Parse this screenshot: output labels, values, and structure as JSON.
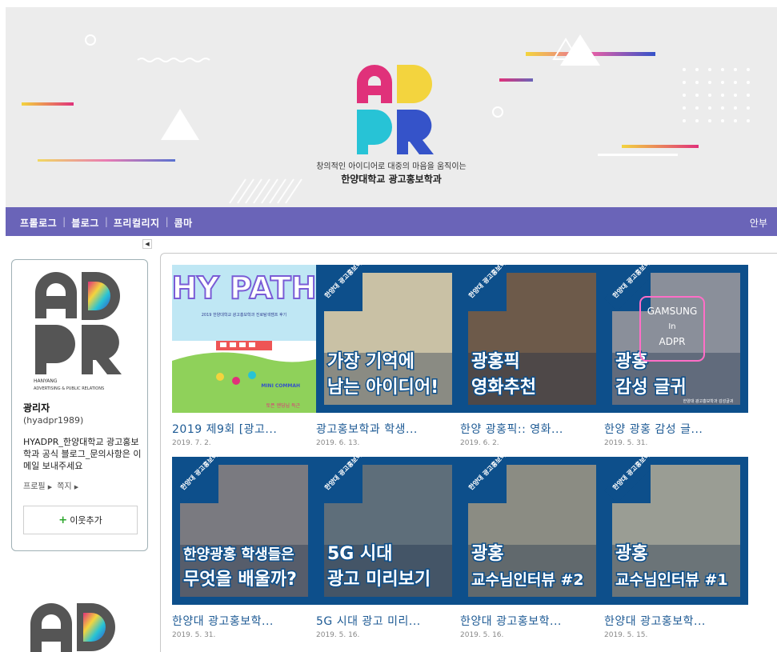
{
  "banner": {
    "tagline": "창의적인 아이디어로 대중의 마음을 움직이는",
    "department": "한양대학교 광고홍보학과",
    "logo_colors": {
      "pink": "#e0317a",
      "yellow": "#f3d43e",
      "cyan": "#27c3d6",
      "blue": "#3553c9"
    }
  },
  "nav": {
    "items": [
      "프롤로그",
      "블로그",
      "프리컬리지",
      "콤마"
    ],
    "guide": "안부",
    "bar_color": "#6a64b8"
  },
  "profile": {
    "logo_sub1": "HANYANG",
    "logo_sub2": "ADVERTISING & PUBLIC RELATIONS",
    "name": "광리자",
    "id": "(hyadpr1989)",
    "description": "HYADPR_한양대학교 광고홍보학과 공식 블로그_문의사항은 이메일 보내주세요",
    "links": [
      "프로필",
      "쪽지"
    ],
    "add_neighbor": "이웃추가"
  },
  "posts": [
    {
      "title": "2019 제9회 [광고...",
      "date": "2019. 7. 2.",
      "thumb": {
        "type": "hypath",
        "big": "HY PATH",
        "sub": "2019 한양대학교 광고홍보학과 진로탐색캠프 후기",
        "caption": "MINI COMMAH",
        "footer": "토픈 엔딩님 득근"
      }
    },
    {
      "title": "광고홍보학과 학생...",
      "date": "2019. 6. 13.",
      "thumb": {
        "type": "badge",
        "badge": "한양대 광고홍보학과",
        "line1": "가장 기억에",
        "line2": "남는 아이디어!"
      }
    },
    {
      "title": "한양 광홍픽:: 영화...",
      "date": "2019. 6. 2.",
      "thumb": {
        "type": "badge",
        "badge": "한양대 광고홍보학과",
        "line1": "광홍픽",
        "line2": "영화추천"
      }
    },
    {
      "title": "한양 광홍 감성 글...",
      "date": "2019. 5. 31.",
      "thumb": {
        "type": "badge",
        "badge": "한양대 광고홍보학과",
        "line1": "광홍",
        "line2": "감성 글귀",
        "neon1": "GAMSUNG",
        "neon2": "In",
        "neon3": "ADPR",
        "footer": "한양대 광고홍보학과 감성글귀"
      }
    },
    {
      "title": "한양대 광고홍보학...",
      "date": "2019. 5. 31.",
      "thumb": {
        "type": "badge",
        "badge": "한양대 광고홍보학과",
        "line1": "한양광홍 학생들은",
        "line2": "무엇을 배울까?"
      }
    },
    {
      "title": "5G 시대 광고 미리...",
      "date": "2019. 5. 16.",
      "thumb": {
        "type": "badge",
        "badge": "한양대 광고홍보학과",
        "line1": "5G 시대",
        "line2": "광고 미리보기"
      }
    },
    {
      "title": "한양대 광고홍보학...",
      "date": "2019. 5. 16.",
      "thumb": {
        "type": "badge",
        "badge": "한양대 광고홍보학과",
        "line1": "광홍",
        "line2": "교수님인터뷰 #2"
      }
    },
    {
      "title": "한양대 광고홍보학...",
      "date": "2019. 5. 15.",
      "thumb": {
        "type": "badge",
        "badge": "한양대 광고홍보학과",
        "line1": "광홍",
        "line2": "교수님인터뷰 #1"
      }
    }
  ]
}
